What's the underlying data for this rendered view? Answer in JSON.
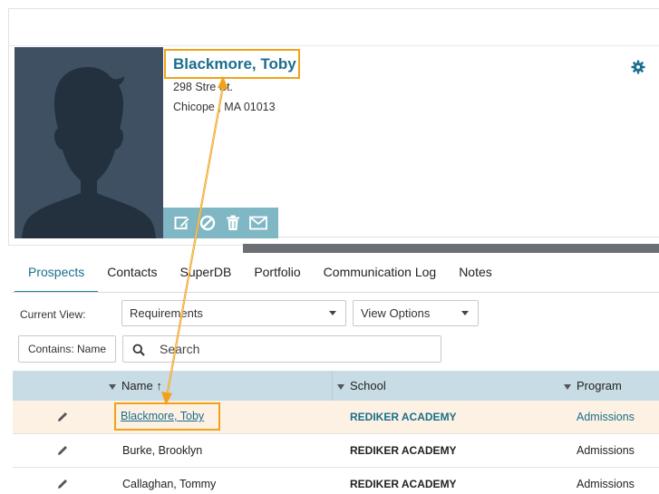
{
  "profile": {
    "name": "Blackmore, Toby",
    "address_line1": "298 Stre   St.",
    "address_line2": "Chicope , MA 01013"
  },
  "tabs": [
    {
      "label": "Prospects",
      "active": true
    },
    {
      "label": "Contacts",
      "active": false
    },
    {
      "label": "SuperDB",
      "active": false
    },
    {
      "label": "Portfolio",
      "active": false
    },
    {
      "label": "Communication Log",
      "active": false
    },
    {
      "label": "Notes",
      "active": false
    }
  ],
  "toolbar": {
    "current_view_label": "Current View:",
    "current_view_value": "Requirements",
    "view_options_label": "View Options",
    "contains_label": "Contains: Name",
    "search_placeholder": "Search"
  },
  "table": {
    "headers": {
      "name": "Name",
      "sort_indicator": "↑",
      "school": "School",
      "program": "Program"
    },
    "rows": [
      {
        "name": "Blackmore, Toby",
        "school": "REDIKER ACADEMY",
        "program": "Admissions",
        "selected": true
      },
      {
        "name": "Burke, Brooklyn",
        "school": "REDIKER ACADEMY",
        "program": "Admissions",
        "selected": false
      },
      {
        "name": "Callaghan, Tommy",
        "school": "REDIKER ACADEMY",
        "program": "Admissions",
        "selected": false
      }
    ]
  },
  "colors": {
    "accent": "#1a6e8e",
    "highlight_border": "#f0a21a",
    "action_bar": "#7fb7c4",
    "header_bg": "#c8dce6",
    "selected_row": "#fcf1e2"
  },
  "icons": [
    "avatar-silhouette",
    "edit-icon",
    "block-icon",
    "trash-icon",
    "mail-icon",
    "gear-icon",
    "search-icon",
    "pencil-icon",
    "filter-icon"
  ]
}
